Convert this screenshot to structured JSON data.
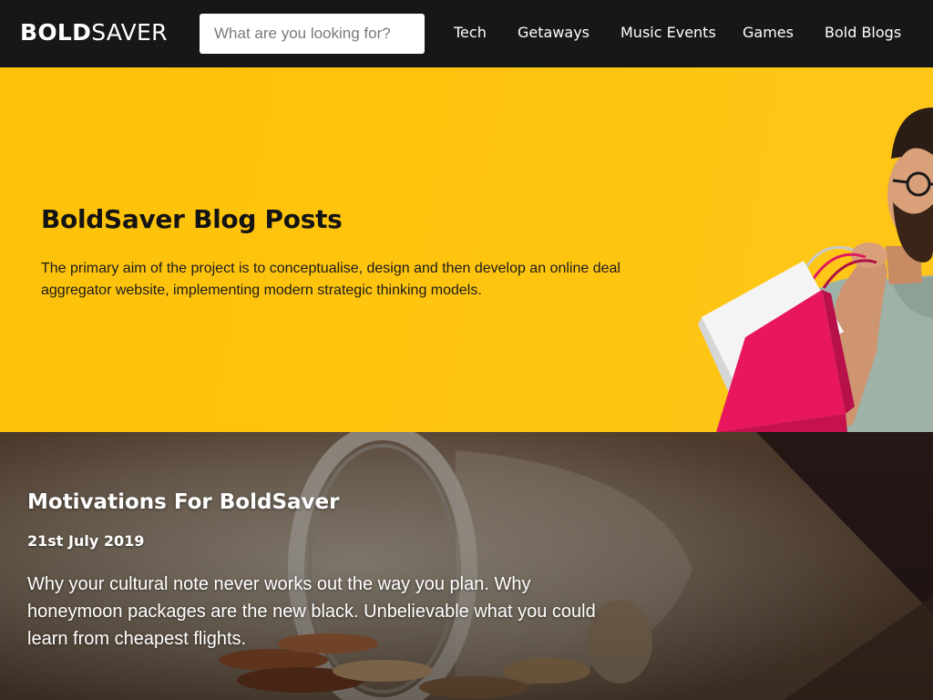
{
  "header": {
    "logo_bold": "BOLD",
    "logo_light": "SAVER",
    "search": {
      "placeholder": "What are you looking for?",
      "value": ""
    },
    "nav": [
      {
        "label": "Tech"
      },
      {
        "label": "Getaways"
      },
      {
        "label": "Music Events"
      },
      {
        "label": "Games"
      },
      {
        "label": "Bold Blogs"
      }
    ]
  },
  "hero": {
    "title": "BoldSaver Blog Posts",
    "description": "The primary aim of the project is to conceptualise, design and then develop an online deal aggregator website, implementing modern strategic thinking models.",
    "background_color": "#fdc20a",
    "image": "man-with-shopping-bags"
  },
  "post": {
    "title": "Motivations For BoldSaver",
    "date": "21st July 2019",
    "excerpt": "Why your cultural note never works out the way you plan. Why honeymoon packages are the new black. Unbelievable what you could learn from cheapest flights.",
    "image": "coins-spilling-from-jar"
  },
  "colors": {
    "header_bg": "#171717",
    "hero_bg": "#fdc20a",
    "bag_pink": "#e8175d",
    "text_light": "#ffffff"
  }
}
